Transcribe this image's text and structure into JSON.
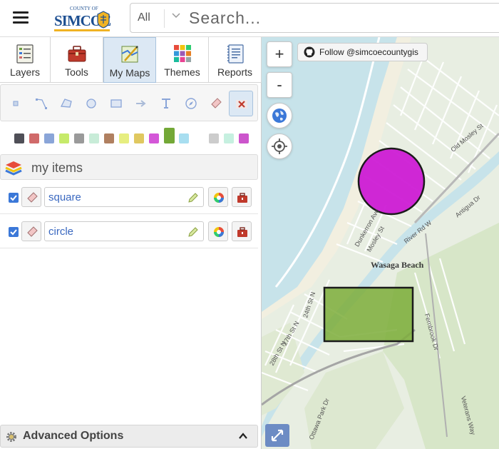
{
  "header": {
    "logo": {
      "county_text": "COUNTY OF",
      "name_text": "SIMCOE"
    },
    "search": {
      "scope": "All",
      "placeholder": "Search..."
    }
  },
  "tabs": [
    {
      "label": "Layers",
      "icon": "layers-icon"
    },
    {
      "label": "Tools",
      "icon": "toolbox-icon"
    },
    {
      "label": "My Maps",
      "icon": "my-maps-icon",
      "active": true
    },
    {
      "label": "Themes",
      "icon": "themes-icon"
    },
    {
      "label": "Reports",
      "icon": "reports-icon"
    }
  ],
  "draw_tools": [
    {
      "name": "point-tool",
      "icon": "point-icon"
    },
    {
      "name": "line-tool",
      "icon": "line-icon"
    },
    {
      "name": "polygon-tool",
      "icon": "polygon-icon"
    },
    {
      "name": "circle-tool",
      "icon": "circle-icon"
    },
    {
      "name": "rectangle-tool",
      "icon": "rectangle-icon"
    },
    {
      "name": "arrow-tool",
      "icon": "arrow-icon"
    },
    {
      "name": "text-tool",
      "icon": "text-icon"
    },
    {
      "name": "measure-tool",
      "icon": "compass-icon"
    },
    {
      "name": "eraser-tool",
      "icon": "eraser-icon"
    },
    {
      "name": "delete-tool",
      "icon": "delete-icon",
      "active": true
    }
  ],
  "colors": [
    "#4f4f57",
    "#d06a6a",
    "#8aa5d8",
    "#c6ea6a",
    "#9a9a9a",
    "#c8ecd8",
    "#b08060",
    "#e6ee80",
    "#e0c860",
    "#d457d8",
    "#73a837",
    "#a8def0",
    "#cccccc",
    "#c6f0e0",
    "#cc55cc"
  ],
  "selected_color": "#73a837",
  "my_items": {
    "title": "my items",
    "items": [
      {
        "label": "square",
        "checked": true
      },
      {
        "label": "circle",
        "checked": true
      }
    ]
  },
  "advanced_options": {
    "label": "Advanced Options"
  },
  "map": {
    "follow_text": "Follow @simcoecountygis",
    "zoom_in": "+",
    "zoom_out": "-",
    "place_label": "Wasaga Beach",
    "road_labels": [
      "Old Mosley St",
      "Antigua Dr",
      "River Rd W",
      "Mosley St",
      "Dunkerron Ave",
      "24th St N",
      "27th St N",
      "28th St N",
      "Fernbrook Dr",
      "Ottawa Park Dr",
      "Veterans Way"
    ],
    "square_color": "#7dad3a",
    "circle_color": "#cc16d4"
  }
}
